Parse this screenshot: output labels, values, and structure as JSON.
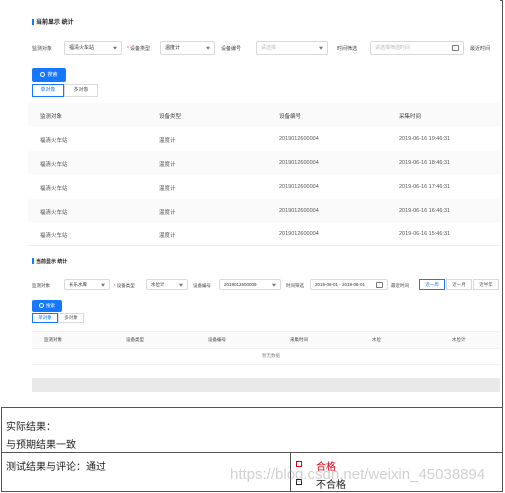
{
  "panel1": {
    "title": "当前显示 统计",
    "filters": {
      "monitor_label": "监测对象",
      "monitor_value": "福清火车站",
      "device_type_label": "设备类型",
      "device_type_value": "温度计",
      "device_no_label": "设备编号",
      "device_no_placeholder": "请选择",
      "time_label": "时间筛选",
      "time_placeholder": "请选择筛选时间",
      "recent_label": "最近时间"
    },
    "search_button": "搜索",
    "tabs": [
      "单对象",
      "多对象"
    ],
    "columns": [
      "监测对象",
      "设备类型",
      "设备编号",
      "采集时间"
    ],
    "rows": [
      [
        "福清火车站",
        "温度计",
        "2019012600004",
        "2019-06-16 19:46:31"
      ],
      [
        "福清火车站",
        "温度计",
        "2019012600004",
        "2019-06-16 18:46:31"
      ],
      [
        "福清火车站",
        "温度计",
        "2019012600004",
        "2019-06-16 17:46:31"
      ],
      [
        "福清火车站",
        "温度计",
        "2019012600004",
        "2019-06-16 16:46:31"
      ],
      [
        "福清火车站",
        "温度计",
        "2019012600004",
        "2019-06-16 15:46:31"
      ]
    ]
  },
  "panel2": {
    "title": "当前显示 统计",
    "filters": {
      "monitor_label": "监测对象",
      "monitor_value": "长乐水库",
      "device_type_label": "设备类型",
      "device_type_value": "水位计",
      "device_no_label": "设备编号",
      "device_no_value": "2019012600009",
      "time_label": "时间筛选",
      "time_value": "2019-06-01 - 2019-06-01",
      "recent_label": "最近时间"
    },
    "range_buttons": [
      "近一周",
      "近一月",
      "近半年"
    ],
    "search_button": "搜索",
    "tabs": [
      "单对象",
      "多对象"
    ],
    "columns": [
      "监测对象",
      "设备类型",
      "设备编号",
      "采集时间",
      "水位",
      "水位计"
    ],
    "empty_text": "暂无数据"
  },
  "result": {
    "actual_label": "实际结果：",
    "actual_text": "与预期结果一致",
    "comment_label": "测试结果与评论：通过",
    "pass_label": "合格",
    "fail_label": "不合格",
    "watermark": "https://blog.csdn.net/weixin_45038894"
  },
  "colors": {
    "accent": "#1677ff",
    "pass": "#d01111"
  }
}
